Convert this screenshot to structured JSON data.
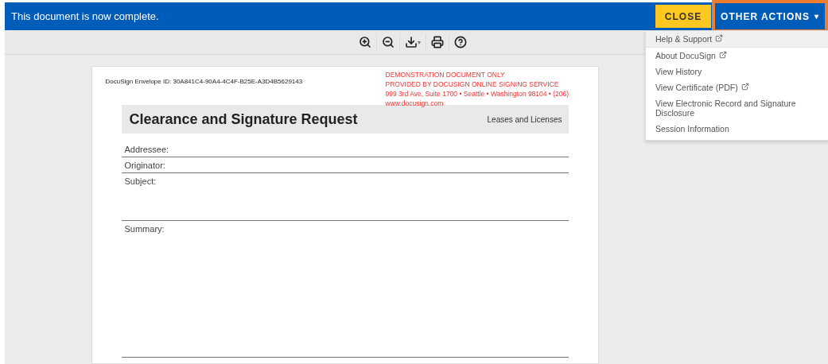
{
  "banner": {
    "message": "This document is now complete.",
    "close_label": "CLOSE",
    "actions_label": "OTHER ACTIONS",
    "actions_caret": "▾",
    "actions_highlighted": true
  },
  "toolbar": {
    "download_caret": "▾"
  },
  "menu": [
    {
      "label": "Help & Support",
      "external": true,
      "selected": true
    },
    {
      "label": "About DocuSign",
      "external": true,
      "selected": false
    },
    {
      "label": "View History",
      "external": false,
      "selected": false
    },
    {
      "label": "View Certificate (PDF)",
      "external": true,
      "selected": false
    },
    {
      "label": "View Electronic Record and Signature Disclosure",
      "external": false,
      "selected": false
    },
    {
      "label": "Session Information",
      "external": false,
      "selected": false
    }
  ],
  "document": {
    "envelope_id": "DocuSign Envelope ID: 30A841C4-90A4-4C4F-B25E-A3D4B5629143",
    "demo_notice": [
      "DEMONSTRATION DOCUMENT ONLY",
      "PROVIDED BY DOCUSIGN ONLINE SIGNING SERVICE",
      "999 3rd Ave, Suite 1700  • Seattle • Washington 98104 • (206)",
      "www.docusign.com"
    ],
    "title": "Clearance and Signature Request",
    "subtitle": "Leases and Licenses",
    "fields": [
      {
        "label": "Addressee:",
        "kind": "line"
      },
      {
        "label": "Originator:",
        "kind": "line"
      },
      {
        "label": "Subject:",
        "kind": "area"
      },
      {
        "label": "Summary:",
        "kind": "large"
      }
    ]
  }
}
